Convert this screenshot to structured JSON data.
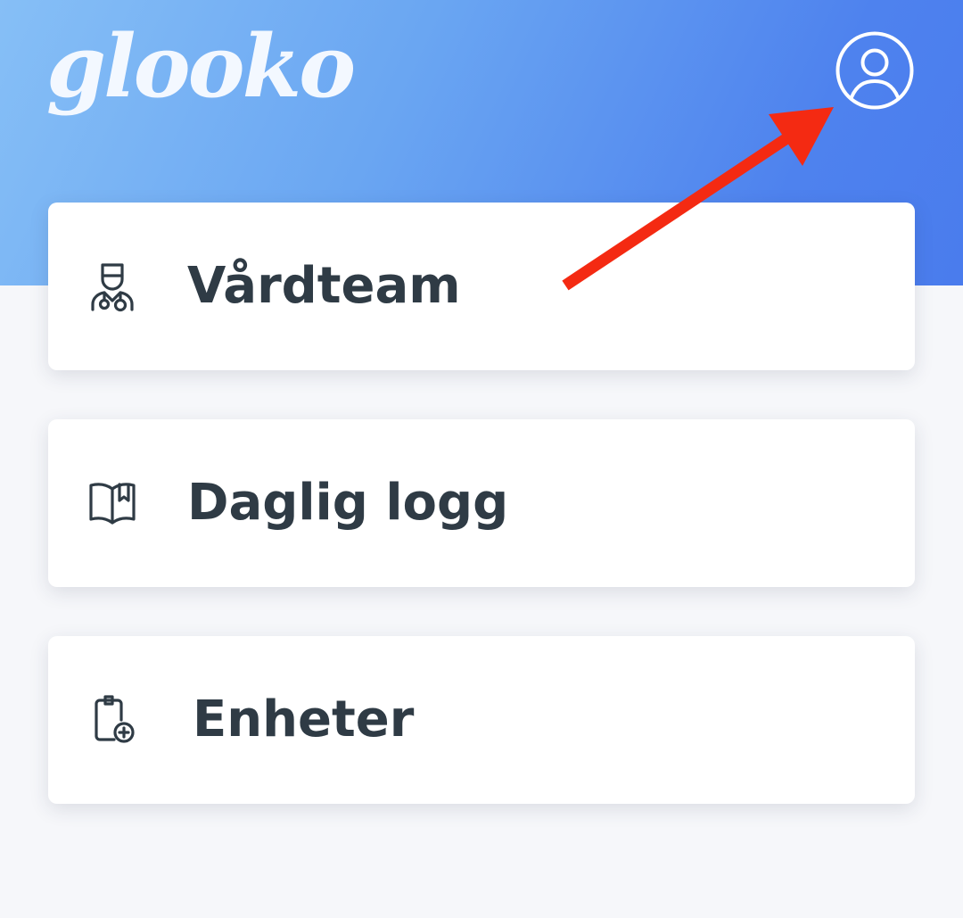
{
  "header": {
    "logo_text": "glooko",
    "profile_icon": "user-circle-icon",
    "background_gradient": [
      "#86bff6",
      "#4a7ced"
    ]
  },
  "menu": {
    "items": [
      {
        "label": "Vårdteam",
        "icon": "doctor-icon"
      },
      {
        "label": "Daglig logg",
        "icon": "open-book-bookmark-icon"
      },
      {
        "label": "Enheter",
        "icon": "device-plus-icon"
      }
    ]
  },
  "annotation": {
    "arrow_color": "#f42a12",
    "points_to": "profile-button"
  },
  "colors": {
    "text": "#2f3b45",
    "page_background": "#f6f7fa",
    "card_background": "#ffffff"
  }
}
